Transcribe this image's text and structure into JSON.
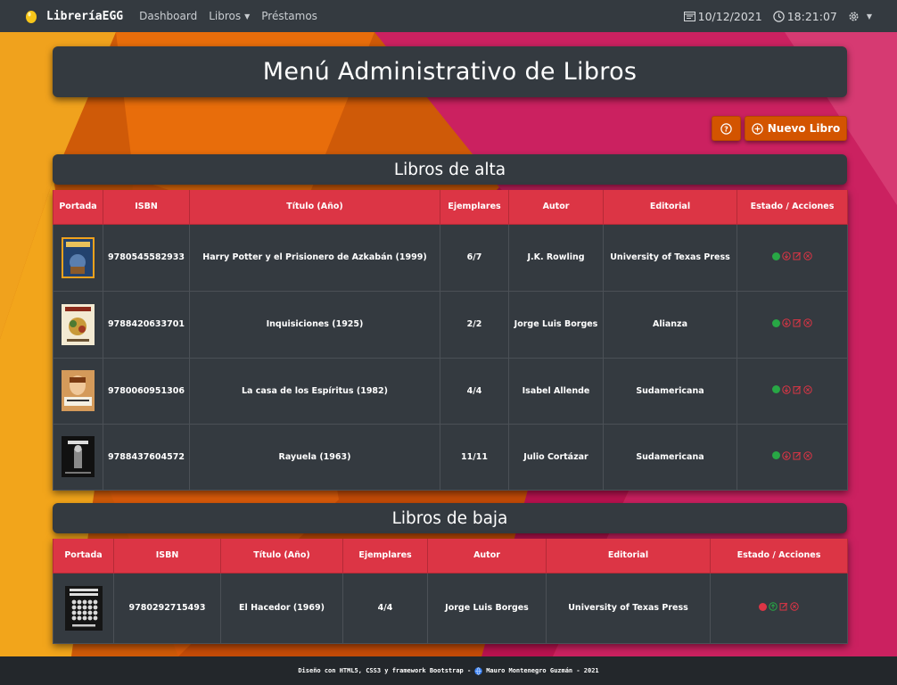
{
  "navbar": {
    "brand": "LibreríaEGG",
    "items": [
      {
        "label": "Dashboard",
        "dropdown": false
      },
      {
        "label": "Libros",
        "dropdown": true
      },
      {
        "label": "Préstamos",
        "dropdown": false
      }
    ],
    "date": "10/12/2021",
    "time": "18:21:07"
  },
  "page": {
    "title": "Menú Administrativo de Libros",
    "new_book_label": "Nuevo Libro"
  },
  "tables": {
    "alta": {
      "heading": "Libros de alta",
      "columns": [
        "Portada",
        "ISBN",
        "Título (Año)",
        "Ejemplares",
        "Autor",
        "Editorial",
        "Estado / Acciones"
      ],
      "rows": [
        {
          "isbn": "9780545582933",
          "title": "Harry Potter y el Prisionero de Azkabán (1999)",
          "copies": "6/7",
          "author": "J.K. Rowling",
          "publisher": "University of Texas Press",
          "status": "active",
          "cover_color": "#2a4c7a"
        },
        {
          "isbn": "9788420633701",
          "title": "Inquisiciones (1925)",
          "copies": "2/2",
          "author": "Jorge Luis Borges",
          "publisher": "Alianza",
          "status": "active",
          "cover_color": "#d8c9a3"
        },
        {
          "isbn": "9780060951306",
          "title": "La casa de los Espíritus (1982)",
          "copies": "4/4",
          "author": "Isabel Allende",
          "publisher": "Sudamericana",
          "status": "active",
          "cover_color": "#c58a4a"
        },
        {
          "isbn": "9788437604572",
          "title": "Rayuela (1963)",
          "copies": "11/11",
          "author": "Julio Cortázar",
          "publisher": "Sudamericana",
          "status": "active",
          "cover_color": "#151515"
        }
      ]
    },
    "baja": {
      "heading": "Libros de baja",
      "columns": [
        "Portada",
        "ISBN",
        "Título (Año)",
        "Ejemplares",
        "Autor",
        "Editorial",
        "Estado / Acciones"
      ],
      "rows": [
        {
          "isbn": "9780292715493",
          "title": "El Hacedor (1969)",
          "copies": "4/4",
          "author": "Jorge Luis Borges",
          "publisher": "University of Texas Press",
          "status": "inactive",
          "cover_color": "#1a1a1a"
        }
      ]
    }
  },
  "footer": {
    "text_left": "Diseño con HTML5, CSS3 y framework Bootstrap -",
    "text_right": "Mauro Montenegro Guzmán - 2021"
  },
  "colors": {
    "navbar": "#343a40",
    "accent_orange": "#d35400",
    "table_header": "#dc3545",
    "status_active": "#28a745",
    "status_inactive": "#dc3545"
  }
}
